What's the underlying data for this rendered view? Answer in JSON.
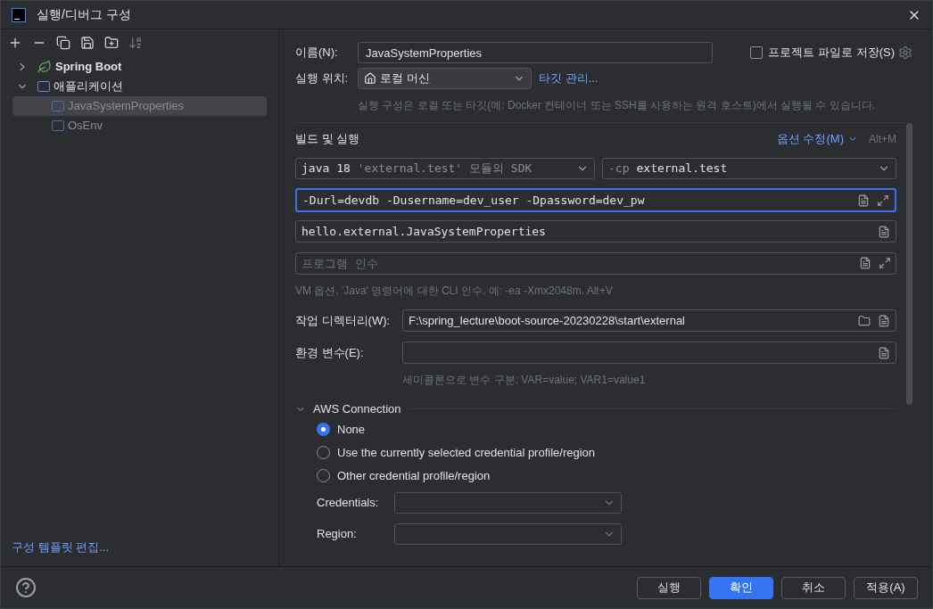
{
  "window": {
    "title": "실행/디버그 구성"
  },
  "sidebar": {
    "tree": [
      {
        "label": "Spring Boot",
        "kind": "spring",
        "expanded": false,
        "selected": false
      },
      {
        "label": "애플리케이션",
        "kind": "app",
        "expanded": true,
        "selected": false,
        "children": [
          {
            "label": "JavaSystemProperties",
            "kind": "app",
            "selected": true
          },
          {
            "label": "OsEnv",
            "kind": "app",
            "selected": false
          }
        ]
      }
    ],
    "footer_link": "구성 템플릿 편집..."
  },
  "form": {
    "name_label": "이름(N):",
    "name_value": "JavaSystemProperties",
    "store_checkbox": {
      "label": "프로젝트 파일로 저장(S)",
      "checked": false
    },
    "run_on_label": "실행 위치:",
    "run_on_value": "로컬 머신",
    "manage_targets": "타깃 관리...",
    "run_on_hint": "실행 구성은 로컬 또는 타깃(예: Docker 컨테이너 또는 SSH를 사용하는 원격 호스트)에서 실행될 수 있습니다.",
    "section_title": "빌드 및 실행",
    "modify_options": "옵션 수정(M)",
    "modify_shortcut": "Alt+M",
    "jdk": {
      "version": "java 18",
      "module": "'external.test' 모듈의 SDK"
    },
    "classpath": {
      "flag": "-cp",
      "value": "external.test"
    },
    "vm_options": "-Durl=devdb -Dusername=dev_user -Dpassword=dev_pw",
    "main_class": "hello.external.JavaSystemProperties",
    "program_args_placeholder": "프로그램 인수",
    "vm_hint": "VM 옵션. 'Java' 명령어에 대한 CLI 인수. 예: -ea -Xmx2048m. Alt+V",
    "workdir_label": "작업 디렉터리(W):",
    "workdir_value": "F:\\spring_lecture\\boot-source-20230228\\start\\external",
    "env_label": "환경 변수(E):",
    "env_hint": "세미콜론으로 변수 구분: VAR=value; VAR1=value1"
  },
  "aws": {
    "title": "AWS Connection",
    "expanded": true,
    "options": [
      {
        "label": "None",
        "selected": true
      },
      {
        "label": "Use the currently selected credential profile/region",
        "selected": false
      },
      {
        "label": "Other credential profile/region",
        "selected": false
      }
    ],
    "credentials_label": "Credentials:",
    "region_label": "Region:"
  },
  "buttons": [
    {
      "label": "실행",
      "primary": false
    },
    {
      "label": "확인",
      "primary": true
    },
    {
      "label": "취소",
      "primary": false
    },
    {
      "label": "적용(A)",
      "primary": false
    }
  ]
}
